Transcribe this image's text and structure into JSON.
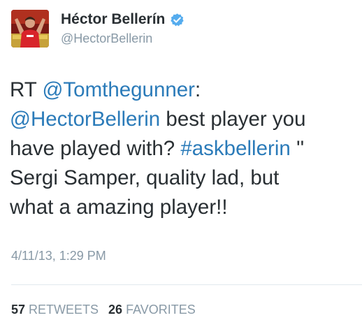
{
  "author": {
    "display_name": "Héctor Bellerín",
    "handle": "@HectorBellerin",
    "verified": true,
    "verified_icon": "verified-badge-icon",
    "avatar_icon": "profile-photo"
  },
  "tweet": {
    "lines": [
      {
        "segments": [
          {
            "text": "RT ",
            "link": false
          },
          {
            "text": "@Tomthegunner",
            "link": true
          },
          {
            "text": ":",
            "link": false
          }
        ]
      },
      {
        "segments": [
          {
            "text": "@HectorBellerin",
            "link": true
          },
          {
            "text": " best player you",
            "link": false
          }
        ]
      },
      {
        "segments": [
          {
            "text": "have played with? ",
            "link": false
          },
          {
            "text": "#askbellerin",
            "link": true
          },
          {
            "text": " ''",
            "link": false
          }
        ]
      },
      {
        "segments": [
          {
            "text": "Sergi Samper, quality lad, but",
            "link": false
          }
        ]
      },
      {
        "segments": [
          {
            "text": "what a amazing player!!",
            "link": false
          }
        ]
      }
    ],
    "timestamp": "4/11/13, 1:29 PM"
  },
  "stats": {
    "retweets_count": "57",
    "retweets_label": "RETWEETS",
    "favorites_count": "26",
    "favorites_label": "FAVORITES"
  },
  "colors": {
    "link": "#2b7bb9",
    "secondary_text": "#8899a6",
    "primary_text": "#292f33",
    "verified": "#55acee",
    "divider": "#e1e8ed"
  }
}
